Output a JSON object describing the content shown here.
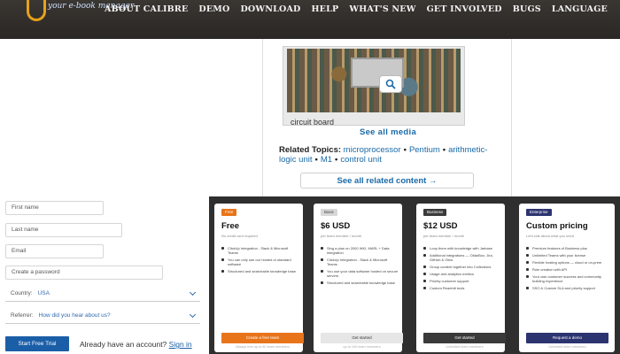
{
  "header": {
    "logo_text": "your e-book manager",
    "nav": [
      "About Calibre",
      "Demo",
      "Download",
      "Help",
      "What's New",
      "Get Involved",
      "Bugs",
      "Language"
    ]
  },
  "media_card": {
    "caption": "circuit board",
    "see_all_media": "See all media",
    "related_label": "Related Topics:",
    "related_links": [
      "microprocessor",
      "Pentium",
      "arithmetic-logic unit",
      "M1",
      "control unit"
    ],
    "see_all_related": "See all related content →"
  },
  "signup": {
    "first_name": "First name",
    "last_name": "Last name",
    "email": "Email",
    "password": "Create a password",
    "country_label": "Country:",
    "country_value": "USA",
    "referrer_label": "Referrer:",
    "referrer_value": "How did you hear about us?",
    "trial_button": "Start Free Trial",
    "already": "Already have an account?",
    "sign_in": "Sign in"
  },
  "pricing": {
    "plans": [
      {
        "badge": "Free",
        "price": "Free",
        "sub": "No credit card required",
        "features": [
          "ClickUp Integration - Slack & Microsoft Teams",
          "You can only use our hosted or standard software",
          "Structured and searchable knowledge base"
        ],
        "button": "Create a free team",
        "foot": "Always free up to 50 team members"
      },
      {
        "badge": "Basic",
        "price": "$6 USD",
        "sub": "per team member / month",
        "features": [
          "Sing a plan on 2000 WKI, MARL + Data integration",
          "ClickUp Integration - Slack & Microsoft Teams",
          "You use your data software hosted on secure servers",
          "Structured and searchable knowledge base"
        ],
        "button": "Get started",
        "foot": "up to 100 team members"
      },
      {
        "badge": "Business",
        "price": "$12 USD",
        "sub": "per team member / month",
        "features": [
          "Loop them with knowledge with Jarbase",
          "Additional integrations — Okta/Box, Jira, GitHub & Okta",
          "Group content together into Collections",
          "Usage and analytics metrics",
          "Priority customer support",
          "Custom Readmit tools"
        ],
        "button": "Get started",
        "foot": "Unlimited team members"
      },
      {
        "badge": "Enterprise",
        "price": "Custom pricing",
        "sub": "Let's talk about what you need",
        "features": [
          "Premium features of Business plus",
          "Unlimited Teams with your license",
          "Flexible hosting options — cloud or on-prem",
          "Role creation with API",
          "Your own customer success and community building experience",
          "SSO & Custom SLA and priority support"
        ],
        "button": "Request a demo",
        "foot": "Unlimited team members"
      }
    ]
  },
  "colors": {
    "header_bg": "#2e2b28",
    "accent_orange": "#e8741a",
    "link_blue": "#1a6aa8",
    "button_blue": "#1b5ea8",
    "enterprise_navy": "#2c3470",
    "business_dark": "#3a3a3a"
  }
}
